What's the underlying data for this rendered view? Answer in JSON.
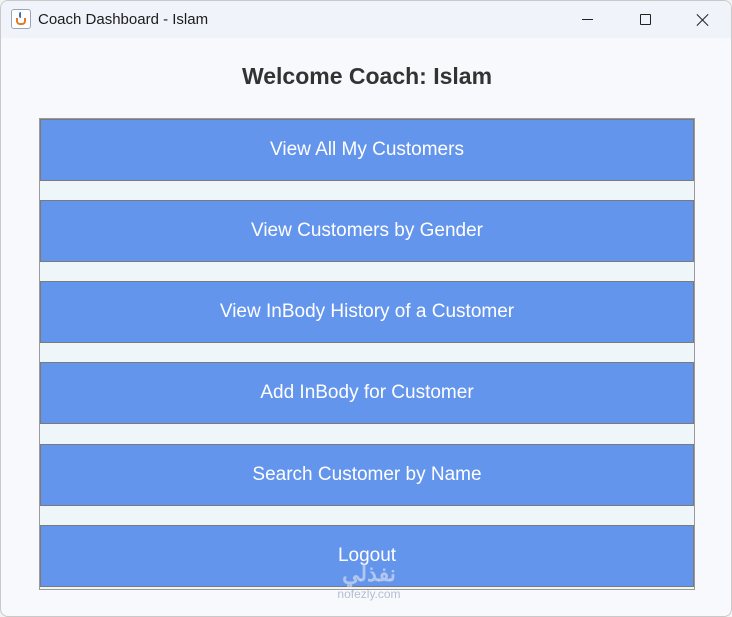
{
  "window": {
    "title": "Coach Dashboard - Islam",
    "icon": "java-cup-icon",
    "controls": {
      "minimize": "minimize-icon",
      "maximize": "maximize-icon",
      "close": "close-icon"
    }
  },
  "main": {
    "heading": "Welcome Coach: Islam",
    "buttons": [
      {
        "label": "View All My Customers"
      },
      {
        "label": "View Customers by Gender"
      },
      {
        "label": "View InBody History of a Customer"
      },
      {
        "label": "Add InBody for Customer"
      },
      {
        "label": "Search Customer by Name"
      },
      {
        "label": "Logout"
      }
    ]
  },
  "watermark": {
    "logo": "نفذلي",
    "url": "nofezly.com"
  },
  "colors": {
    "button": "#6495ed",
    "panel": "#eef6f9",
    "heading": "#333333"
  }
}
